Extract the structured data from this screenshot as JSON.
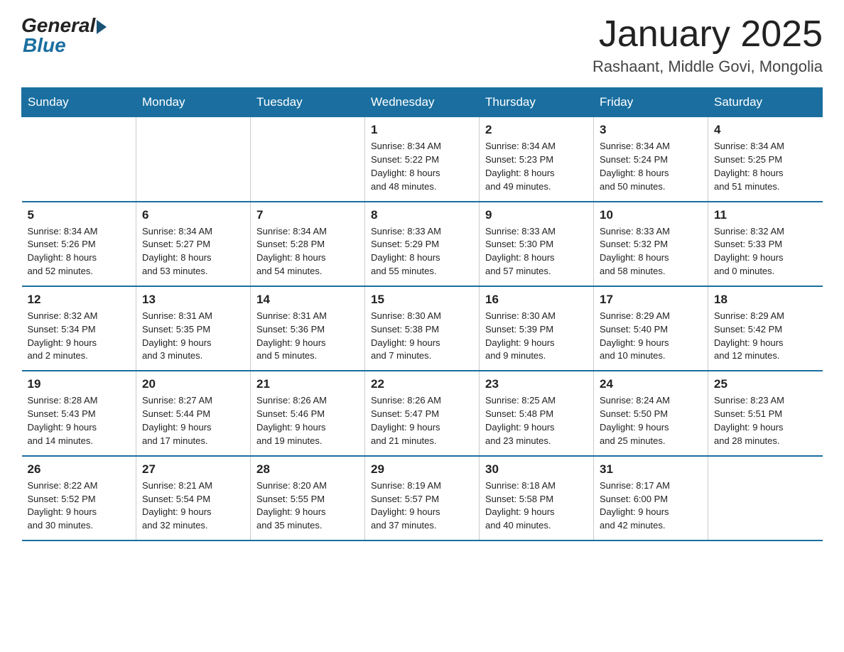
{
  "logo": {
    "general": "General",
    "blue": "Blue"
  },
  "title": "January 2025",
  "location": "Rashaant, Middle Govi, Mongolia",
  "days_of_week": [
    "Sunday",
    "Monday",
    "Tuesday",
    "Wednesday",
    "Thursday",
    "Friday",
    "Saturday"
  ],
  "weeks": [
    [
      {
        "day": "",
        "info": ""
      },
      {
        "day": "",
        "info": ""
      },
      {
        "day": "",
        "info": ""
      },
      {
        "day": "1",
        "info": "Sunrise: 8:34 AM\nSunset: 5:22 PM\nDaylight: 8 hours\nand 48 minutes."
      },
      {
        "day": "2",
        "info": "Sunrise: 8:34 AM\nSunset: 5:23 PM\nDaylight: 8 hours\nand 49 minutes."
      },
      {
        "day": "3",
        "info": "Sunrise: 8:34 AM\nSunset: 5:24 PM\nDaylight: 8 hours\nand 50 minutes."
      },
      {
        "day": "4",
        "info": "Sunrise: 8:34 AM\nSunset: 5:25 PM\nDaylight: 8 hours\nand 51 minutes."
      }
    ],
    [
      {
        "day": "5",
        "info": "Sunrise: 8:34 AM\nSunset: 5:26 PM\nDaylight: 8 hours\nand 52 minutes."
      },
      {
        "day": "6",
        "info": "Sunrise: 8:34 AM\nSunset: 5:27 PM\nDaylight: 8 hours\nand 53 minutes."
      },
      {
        "day": "7",
        "info": "Sunrise: 8:34 AM\nSunset: 5:28 PM\nDaylight: 8 hours\nand 54 minutes."
      },
      {
        "day": "8",
        "info": "Sunrise: 8:33 AM\nSunset: 5:29 PM\nDaylight: 8 hours\nand 55 minutes."
      },
      {
        "day": "9",
        "info": "Sunrise: 8:33 AM\nSunset: 5:30 PM\nDaylight: 8 hours\nand 57 minutes."
      },
      {
        "day": "10",
        "info": "Sunrise: 8:33 AM\nSunset: 5:32 PM\nDaylight: 8 hours\nand 58 minutes."
      },
      {
        "day": "11",
        "info": "Sunrise: 8:32 AM\nSunset: 5:33 PM\nDaylight: 9 hours\nand 0 minutes."
      }
    ],
    [
      {
        "day": "12",
        "info": "Sunrise: 8:32 AM\nSunset: 5:34 PM\nDaylight: 9 hours\nand 2 minutes."
      },
      {
        "day": "13",
        "info": "Sunrise: 8:31 AM\nSunset: 5:35 PM\nDaylight: 9 hours\nand 3 minutes."
      },
      {
        "day": "14",
        "info": "Sunrise: 8:31 AM\nSunset: 5:36 PM\nDaylight: 9 hours\nand 5 minutes."
      },
      {
        "day": "15",
        "info": "Sunrise: 8:30 AM\nSunset: 5:38 PM\nDaylight: 9 hours\nand 7 minutes."
      },
      {
        "day": "16",
        "info": "Sunrise: 8:30 AM\nSunset: 5:39 PM\nDaylight: 9 hours\nand 9 minutes."
      },
      {
        "day": "17",
        "info": "Sunrise: 8:29 AM\nSunset: 5:40 PM\nDaylight: 9 hours\nand 10 minutes."
      },
      {
        "day": "18",
        "info": "Sunrise: 8:29 AM\nSunset: 5:42 PM\nDaylight: 9 hours\nand 12 minutes."
      }
    ],
    [
      {
        "day": "19",
        "info": "Sunrise: 8:28 AM\nSunset: 5:43 PM\nDaylight: 9 hours\nand 14 minutes."
      },
      {
        "day": "20",
        "info": "Sunrise: 8:27 AM\nSunset: 5:44 PM\nDaylight: 9 hours\nand 17 minutes."
      },
      {
        "day": "21",
        "info": "Sunrise: 8:26 AM\nSunset: 5:46 PM\nDaylight: 9 hours\nand 19 minutes."
      },
      {
        "day": "22",
        "info": "Sunrise: 8:26 AM\nSunset: 5:47 PM\nDaylight: 9 hours\nand 21 minutes."
      },
      {
        "day": "23",
        "info": "Sunrise: 8:25 AM\nSunset: 5:48 PM\nDaylight: 9 hours\nand 23 minutes."
      },
      {
        "day": "24",
        "info": "Sunrise: 8:24 AM\nSunset: 5:50 PM\nDaylight: 9 hours\nand 25 minutes."
      },
      {
        "day": "25",
        "info": "Sunrise: 8:23 AM\nSunset: 5:51 PM\nDaylight: 9 hours\nand 28 minutes."
      }
    ],
    [
      {
        "day": "26",
        "info": "Sunrise: 8:22 AM\nSunset: 5:52 PM\nDaylight: 9 hours\nand 30 minutes."
      },
      {
        "day": "27",
        "info": "Sunrise: 8:21 AM\nSunset: 5:54 PM\nDaylight: 9 hours\nand 32 minutes."
      },
      {
        "day": "28",
        "info": "Sunrise: 8:20 AM\nSunset: 5:55 PM\nDaylight: 9 hours\nand 35 minutes."
      },
      {
        "day": "29",
        "info": "Sunrise: 8:19 AM\nSunset: 5:57 PM\nDaylight: 9 hours\nand 37 minutes."
      },
      {
        "day": "30",
        "info": "Sunrise: 8:18 AM\nSunset: 5:58 PM\nDaylight: 9 hours\nand 40 minutes."
      },
      {
        "day": "31",
        "info": "Sunrise: 8:17 AM\nSunset: 6:00 PM\nDaylight: 9 hours\nand 42 minutes."
      },
      {
        "day": "",
        "info": ""
      }
    ]
  ]
}
